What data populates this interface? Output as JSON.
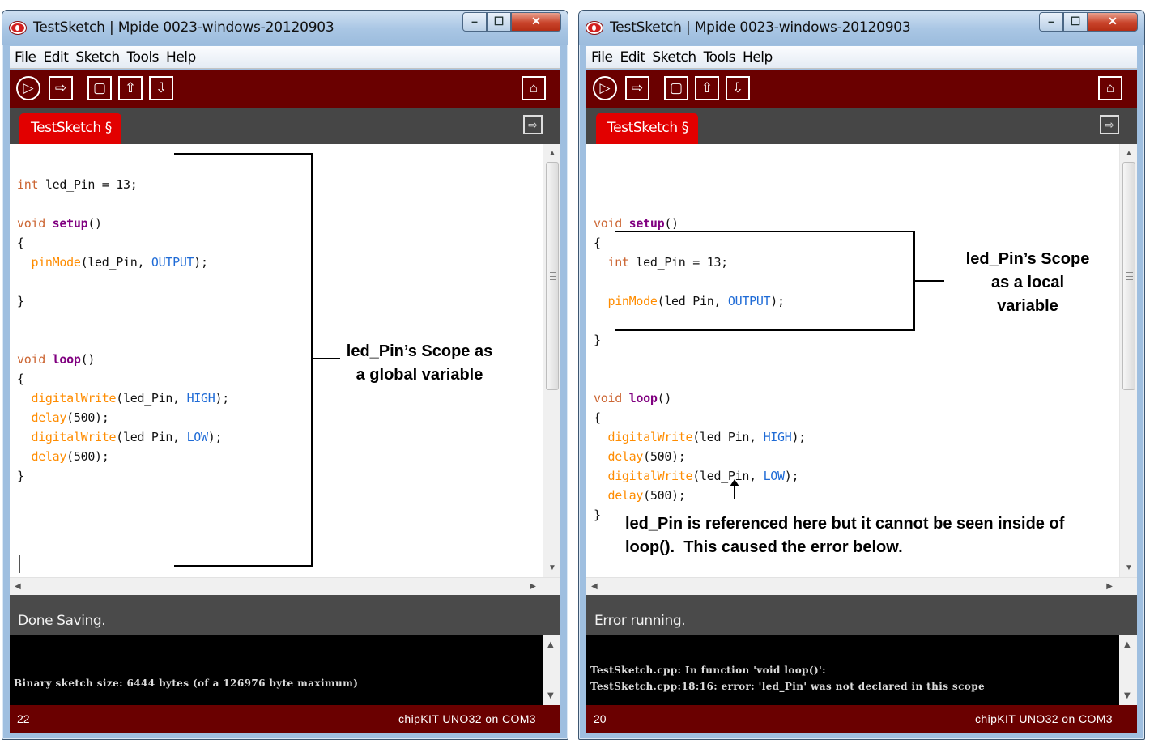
{
  "left_window": {
    "title": "TestSketch | Mpide 0023-windows-20120903",
    "menu": [
      "File",
      "Edit",
      "Sketch",
      "Tools",
      "Help"
    ],
    "tab_label": "TestSketch §",
    "status": "Done Saving.",
    "console_lines": [
      "Binary sketch size: 6444 bytes (of a 126976 byte maximum)"
    ],
    "line_number": "22",
    "board": "chipKIT UNO32 on COM3"
  },
  "right_window": {
    "title": "TestSketch | Mpide 0023-windows-20120903",
    "menu": [
      "File",
      "Edit",
      "Sketch",
      "Tools",
      "Help"
    ],
    "tab_label": "TestSketch §",
    "status": "Error running.",
    "console_lines": [
      "TestSketch.cpp: In function 'void loop()':",
      "TestSketch.cpp:18:16: error: 'led_Pin' was not declared in this scope"
    ],
    "line_number": "20",
    "board": "chipKIT UNO32 on COM3"
  },
  "window_controls": {
    "minimize": "–",
    "maximize": "☐",
    "close": "✕"
  },
  "toolbar_icons": [
    "verify-icon",
    "upload-icon",
    "new-icon",
    "open-icon",
    "save-icon",
    "serial-monitor-icon"
  ],
  "code_tokens": {
    "int": "int",
    "void": "void",
    "setup": "setup",
    "loop": "loop",
    "pinMode": "pinMode",
    "digitalWrite": "digitalWrite",
    "delay": "delay",
    "OUTPUT": "OUTPUT",
    "HIGH": "HIGH",
    "LOW": "LOW"
  },
  "left_code": {
    "decl": " led_Pin = 13;",
    "setup_parens": "()",
    "open_brace": "{",
    "close_brace": "}",
    "pinmode_args_a": "(led_Pin, ",
    "pinmode_args_b": ");",
    "dw_args": "(led_Pin, ",
    "dw_end": ");",
    "delay_args": "(500);"
  },
  "annotations": {
    "left_scope": [
      "led_Pin’s Scope as",
      "a global variable"
    ],
    "right_scope": [
      "led_Pin’s Scope",
      "as a local",
      "variable"
    ],
    "right_error": [
      "led_Pin is referenced here but it cannot be seen inside of",
      "loop().  This caused the error below."
    ]
  }
}
